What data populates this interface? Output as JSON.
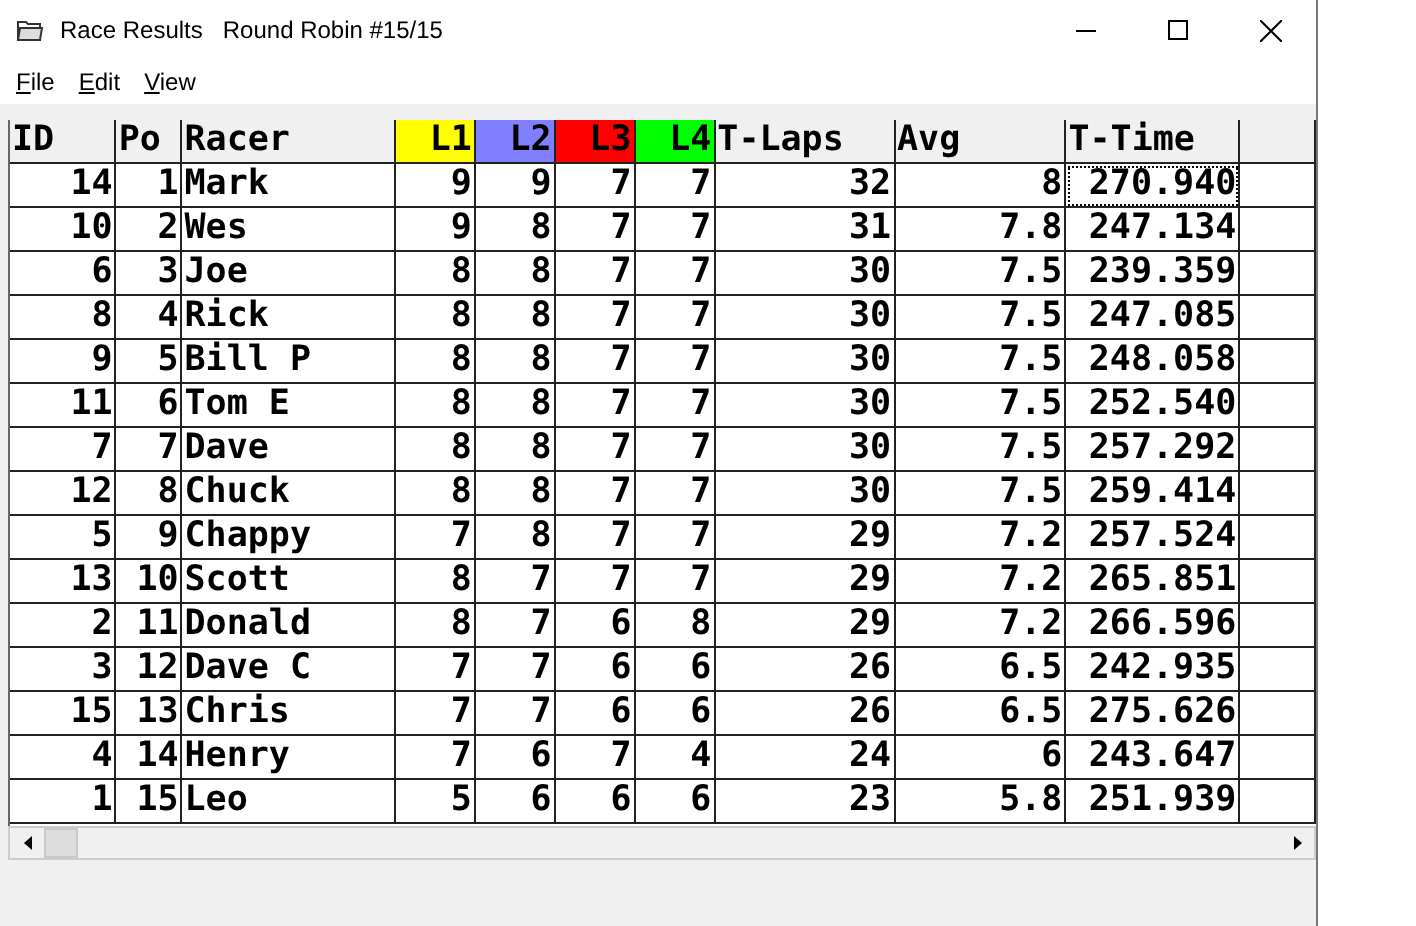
{
  "window": {
    "title": "Race Results",
    "subtitle": "Round Robin #15/15"
  },
  "menu": [
    {
      "label": "File"
    },
    {
      "label": "Edit"
    },
    {
      "label": "View"
    }
  ],
  "table": {
    "columns": [
      {
        "label": "ID",
        "kind": "number"
      },
      {
        "label": "Po",
        "kind": "number"
      },
      {
        "label": "Racer",
        "kind": "text"
      },
      {
        "label": "L1",
        "kind": "number",
        "color": "#ffff00"
      },
      {
        "label": "L2",
        "kind": "number",
        "color": "#8080ff"
      },
      {
        "label": "L3",
        "kind": "number",
        "color": "#ff0000"
      },
      {
        "label": "L4",
        "kind": "number",
        "color": "#00ff00"
      },
      {
        "label": "T-Laps",
        "kind": "number"
      },
      {
        "label": "Avg",
        "kind": "number"
      },
      {
        "label": "T-Time",
        "kind": "number"
      }
    ],
    "rows": [
      {
        "cells": [
          "14",
          "1",
          "Mark",
          "9",
          "9",
          "7",
          "7",
          "32",
          "8",
          "270.940"
        ],
        "focused": true
      },
      {
        "cells": [
          "10",
          "2",
          "Wes",
          "9",
          "8",
          "7",
          "7",
          "31",
          "7.8",
          "247.134"
        ],
        "focused": false
      },
      {
        "cells": [
          "6",
          "3",
          "Joe",
          "8",
          "8",
          "7",
          "7",
          "30",
          "7.5",
          "239.359"
        ],
        "focused": false
      },
      {
        "cells": [
          "8",
          "4",
          "Rick",
          "8",
          "8",
          "7",
          "7",
          "30",
          "7.5",
          "247.085"
        ],
        "focused": false
      },
      {
        "cells": [
          "9",
          "5",
          "Bill P",
          "8",
          "8",
          "7",
          "7",
          "30",
          "7.5",
          "248.058"
        ],
        "focused": false
      },
      {
        "cells": [
          "11",
          "6",
          "Tom E",
          "8",
          "8",
          "7",
          "7",
          "30",
          "7.5",
          "252.540"
        ],
        "focused": false
      },
      {
        "cells": [
          "7",
          "7",
          "Dave",
          "8",
          "8",
          "7",
          "7",
          "30",
          "7.5",
          "257.292"
        ],
        "focused": false
      },
      {
        "cells": [
          "12",
          "8",
          "Chuck",
          "8",
          "8",
          "7",
          "7",
          "30",
          "7.5",
          "259.414"
        ],
        "focused": false
      },
      {
        "cells": [
          "5",
          "9",
          "Chappy",
          "7",
          "8",
          "7",
          "7",
          "29",
          "7.2",
          "257.524"
        ],
        "focused": false
      },
      {
        "cells": [
          "13",
          "10",
          "Scott",
          "8",
          "7",
          "7",
          "7",
          "29",
          "7.2",
          "265.851"
        ],
        "focused": false
      },
      {
        "cells": [
          "2",
          "11",
          "Donald",
          "8",
          "7",
          "6",
          "8",
          "29",
          "7.2",
          "266.596"
        ],
        "focused": false
      },
      {
        "cells": [
          "3",
          "12",
          "Dave C",
          "7",
          "7",
          "6",
          "6",
          "26",
          "6.5",
          "242.935"
        ],
        "focused": false
      },
      {
        "cells": [
          "15",
          "13",
          "Chris",
          "7",
          "7",
          "6",
          "6",
          "26",
          "6.5",
          "275.626"
        ],
        "focused": false
      },
      {
        "cells": [
          "4",
          "14",
          "Henry",
          "7",
          "6",
          "7",
          "4",
          "24",
          "6",
          "243.647"
        ],
        "focused": false
      },
      {
        "cells": [
          "1",
          "15",
          "Leo",
          "5",
          "6",
          "6",
          "6",
          "23",
          "5.8",
          "251.939"
        ],
        "focused": false
      }
    ]
  }
}
